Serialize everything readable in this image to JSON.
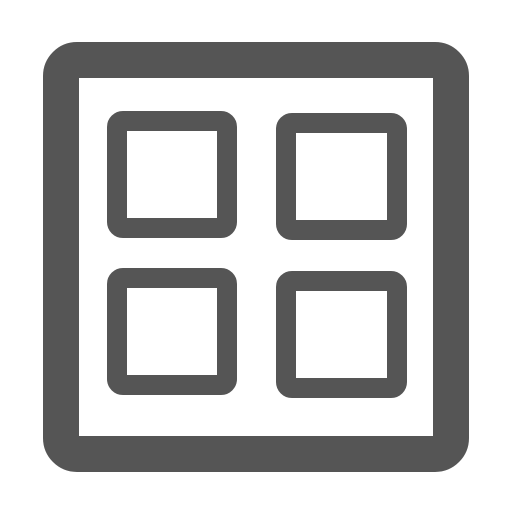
{
  "icon": {
    "name": "grid-view-icon",
    "color": "#555555",
    "background": "#ffffff"
  }
}
